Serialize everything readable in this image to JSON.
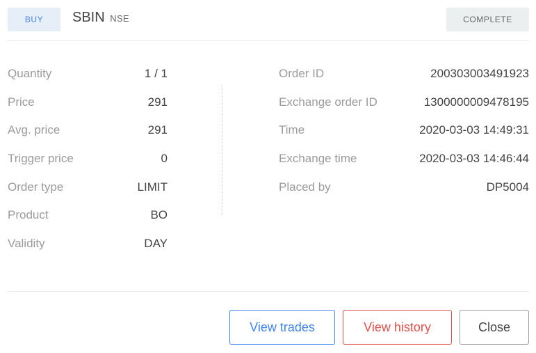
{
  "header": {
    "transaction_type": "BUY",
    "symbol": "SBIN",
    "exchange": "NSE",
    "status": "COMPLETE"
  },
  "details_left": [
    {
      "label": "Quantity",
      "value": "1 / 1"
    },
    {
      "label": "Price",
      "value": "291"
    },
    {
      "label": "Avg. price",
      "value": "291"
    },
    {
      "label": "Trigger price",
      "value": "0"
    },
    {
      "label": "Order type",
      "value": "LIMIT"
    },
    {
      "label": "Product",
      "value": "BO"
    },
    {
      "label": "Validity",
      "value": "DAY"
    }
  ],
  "details_right": [
    {
      "label": "Order ID",
      "value": "200303003491923"
    },
    {
      "label": "Exchange order ID",
      "value": "1300000009478195"
    },
    {
      "label": "Time",
      "value": "2020-03-03 14:49:31"
    },
    {
      "label": "Exchange time",
      "value": "2020-03-03 14:46:44"
    },
    {
      "label": "Placed by",
      "value": "DP5004"
    }
  ],
  "actions": {
    "view_trades": "View trades",
    "view_history": "View history",
    "close": "Close"
  },
  "colors": {
    "buy_accent": "#4184f3",
    "history_accent": "#df514c",
    "label_grey": "#9b9b9b"
  }
}
